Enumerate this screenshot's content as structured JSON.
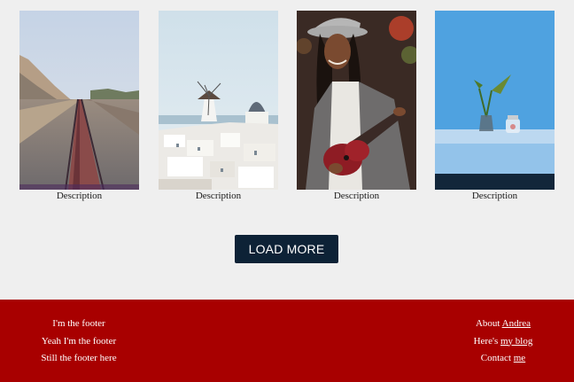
{
  "gallery": {
    "items": [
      {
        "caption": "Description",
        "image": "railway-tracks-photo"
      },
      {
        "caption": "Description",
        "image": "santorini-windmill-photo"
      },
      {
        "caption": "Description",
        "image": "woman-with-guitar-photo"
      },
      {
        "caption": "Description",
        "image": "plant-on-blue-table-photo"
      }
    ]
  },
  "load_more": {
    "label": "LOAD MORE"
  },
  "footer": {
    "background": "#a80000",
    "left": [
      "I'm the footer",
      "Yeah I'm the footer",
      "Still the footer here"
    ],
    "right": [
      {
        "prefix": "About ",
        "link": "Andrea"
      },
      {
        "prefix": "Here's ",
        "link": "my blog"
      },
      {
        "prefix": "Contact ",
        "link": "me"
      }
    ]
  },
  "colors": {
    "button_bg": "#0d2236",
    "page_bg": "#efefef"
  }
}
